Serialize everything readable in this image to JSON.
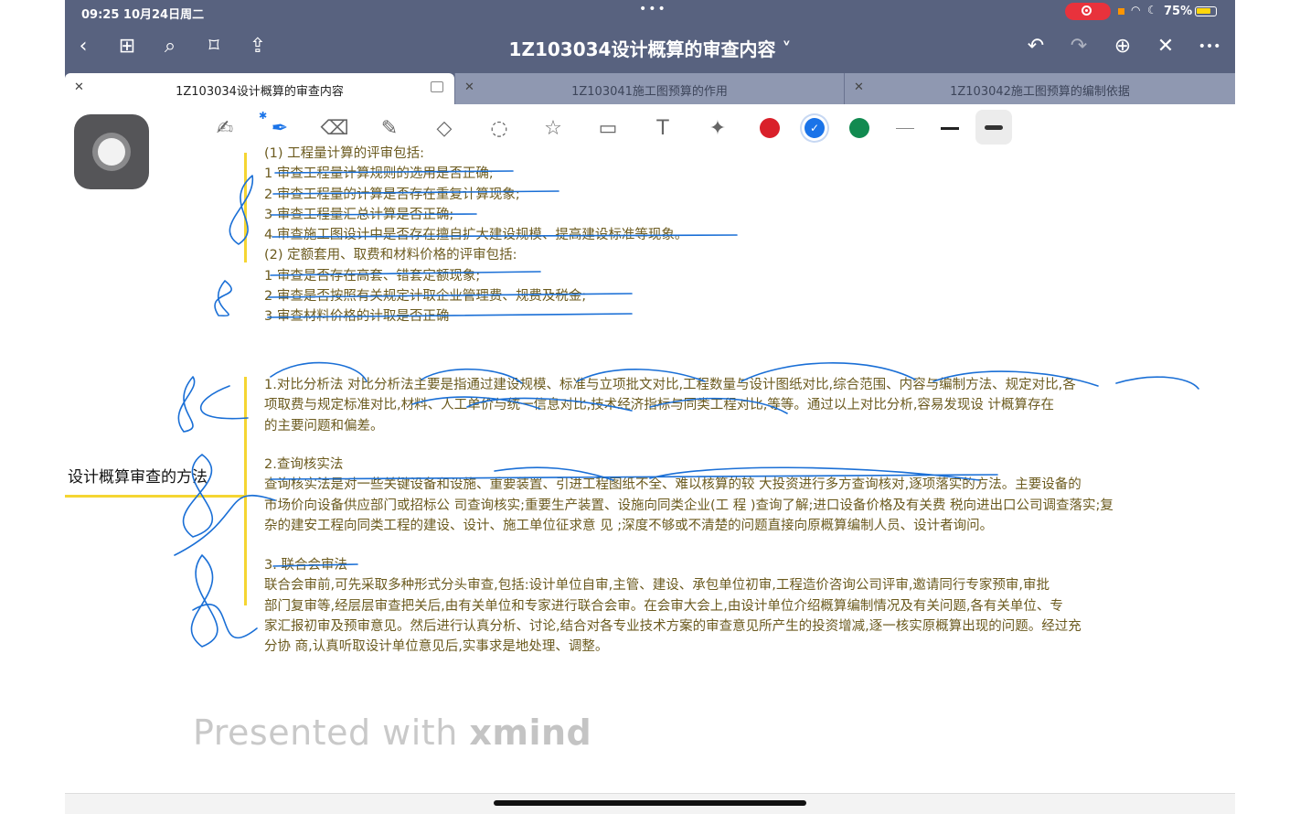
{
  "status": {
    "time": "09:25  10月24日周二",
    "dots": "•••",
    "battery": "75%",
    "wifi_icon": "wifi-icon",
    "moon_icon": "moon-icon"
  },
  "nav": {
    "title": "1Z103034设计概算的审查内容 ˅",
    "back": "‹",
    "grid": "⊞",
    "search": "⌕",
    "bookmark": "⌑",
    "share": "⇪",
    "undo": "↶",
    "redo": "↷",
    "add_page": "⊕",
    "close_x": "✕",
    "more": "•••"
  },
  "tabs": [
    {
      "label": "1Z103034设计概算的审查内容",
      "close": "✕"
    },
    {
      "label": "1Z103041施工图预算的作用",
      "close": "✕"
    },
    {
      "label": "1Z103042施工图预算的编制依据",
      "close": "✕"
    }
  ],
  "toolbar": {
    "colors": [
      "#d9202a",
      "#1a73e8",
      "#118a50"
    ],
    "selected_color": "#1a73e8",
    "tools": [
      "handwriting-zoom-icon",
      "pen-icon",
      "eraser-icon",
      "highlighter-icon",
      "shapes-icon",
      "lasso-icon",
      "sticker-icon",
      "image-icon",
      "text-icon",
      "laser-pointer-icon"
    ],
    "bluetooth": "✱",
    "check": "✓"
  },
  "mindmap": {
    "central_topic": "设计概算审查的方法",
    "block1": [
      "(1) 工程量计算的评审包括:",
      "1 审查工程量计算规则的选用是否正确;",
      "2 审查工程量的计算是否存在重复计算现象;",
      "3 审查工程量汇总计算是否正确;",
      "4 审查施工图设计中是否存在擅自扩大建设规模、提高建设标准等现象。",
      "(2) 定额套用、取费和材料价格的评审包括:",
      "1 审查是否存在高套、错套定额现象;",
      "2 审查是否按照有关规定计取企业管理费、规费及税金;",
      "3 审查材料价格的计取是否正确"
    ],
    "block2": [
      "1.对比分析法 对比分析法主要是指通过建设规模、标准与立项批文对比,工程数量与设计图纸对比,综合范围、内容与编制方法、规定对比,各",
      "项取费与规定标准对比,材料、人工单价与统一信息对比,技术经济指标与同类工程对比,等等。通过以上对比分析,容易发现设 计概算存在",
      "的主要问题和偏差。"
    ],
    "block3": [
      "2.查询核实法",
      "查询核实法是对一些关键设备和设施、重要装置、引进工程图纸不全、难以核算的较 大投资进行多方查询核对,逐项落实的方法。主要设备的",
      "市场价向设备供应部门或招标公 司查询核实;重要生产装置、设施向同类企业(工 程 )查询了解;进口设备价格及有关费 税向进出口公司调查落实;复",
      "杂的建安工程向同类工程的建设、设计、施工单位征求意 见 ;深度不够或不清楚的问题直接向原概算编制人员、设计者询问。"
    ],
    "block4": [
      "3. 联合会审法",
      "联合会审前,可先采取多种形式分头审查,包括:设计单位自审,主管、建设、承包单位初审,工程造价咨询公司评审,邀请同行专家预审,审批",
      "部门复审等,经层层审查把关后,由有关单位和专家进行联合会审。在会审大会上,由设计单位介绍概算编制情况及有关问题,各有关单位、专",
      "家汇报初审及预审意见。然后进行认真分析、讨论,结合对各专业技术方案的审查意见所产生的投资增减,逐一核实原概算出现的问题。经过充",
      "分协 商,认真听取设计单位意见后,实事求是地处理、调整。"
    ]
  },
  "watermark": {
    "prefix": "Presented with ",
    "brand": "xmind"
  }
}
